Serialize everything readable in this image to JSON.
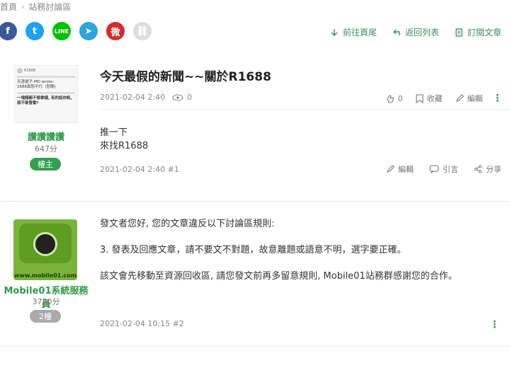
{
  "breadcrumb": {
    "home": "首頁",
    "separator": "›",
    "current": "站務討論區"
  },
  "share": {
    "line": "LINE",
    "facebook": "f",
    "twitter": "t",
    "telegram": "➤",
    "weibo": "微",
    "link": "⛓"
  },
  "actions": {
    "prev": "前往頁尾",
    "back": "返回列表",
    "subscribe": "訂閱文章"
  },
  "thread": {
    "title": "今天最假的新聞~~關於R1688"
  },
  "post1": {
    "author": "讚讚讚讚",
    "score": "647分",
    "badge": "樓主",
    "date": "2021-02-04 2:40",
    "views": "0",
    "likes": "0",
    "favorite": "收藏",
    "edit": "編輯",
    "body": [
      "推一下",
      "來找R1688"
    ],
    "footer": "2021-02-04 2:40 #1",
    "quote": "引言",
    "share": "分享",
    "avatar_text": {
      "name": "R1688",
      "quote": "天涯遊子-MD wrote:",
      "quote2": "1688真怒不行. (恕刪)",
      "body": "一塊錢都不想拿錢, 有的話你耗, 就不敢發誓?"
    }
  },
  "post2": {
    "author": "Mobile01系統服務員",
    "score": "3780分",
    "badge": "2樓",
    "avatar_url": "www.mobile01.com",
    "body": [
      "發文者您好, 您的文章違反以下討論區規則:",
      "3. 發表及回應文章，請不要文不對題，故意離題或語意不明，選字要正確。",
      "該文會先移動至資源回收區, 請您發文前再多留意規則, Mobile01站務群感謝您的合作。"
    ],
    "footer": "2021-02-04 10:15 #2"
  },
  "colors": {
    "accent": "#2e9a47"
  }
}
